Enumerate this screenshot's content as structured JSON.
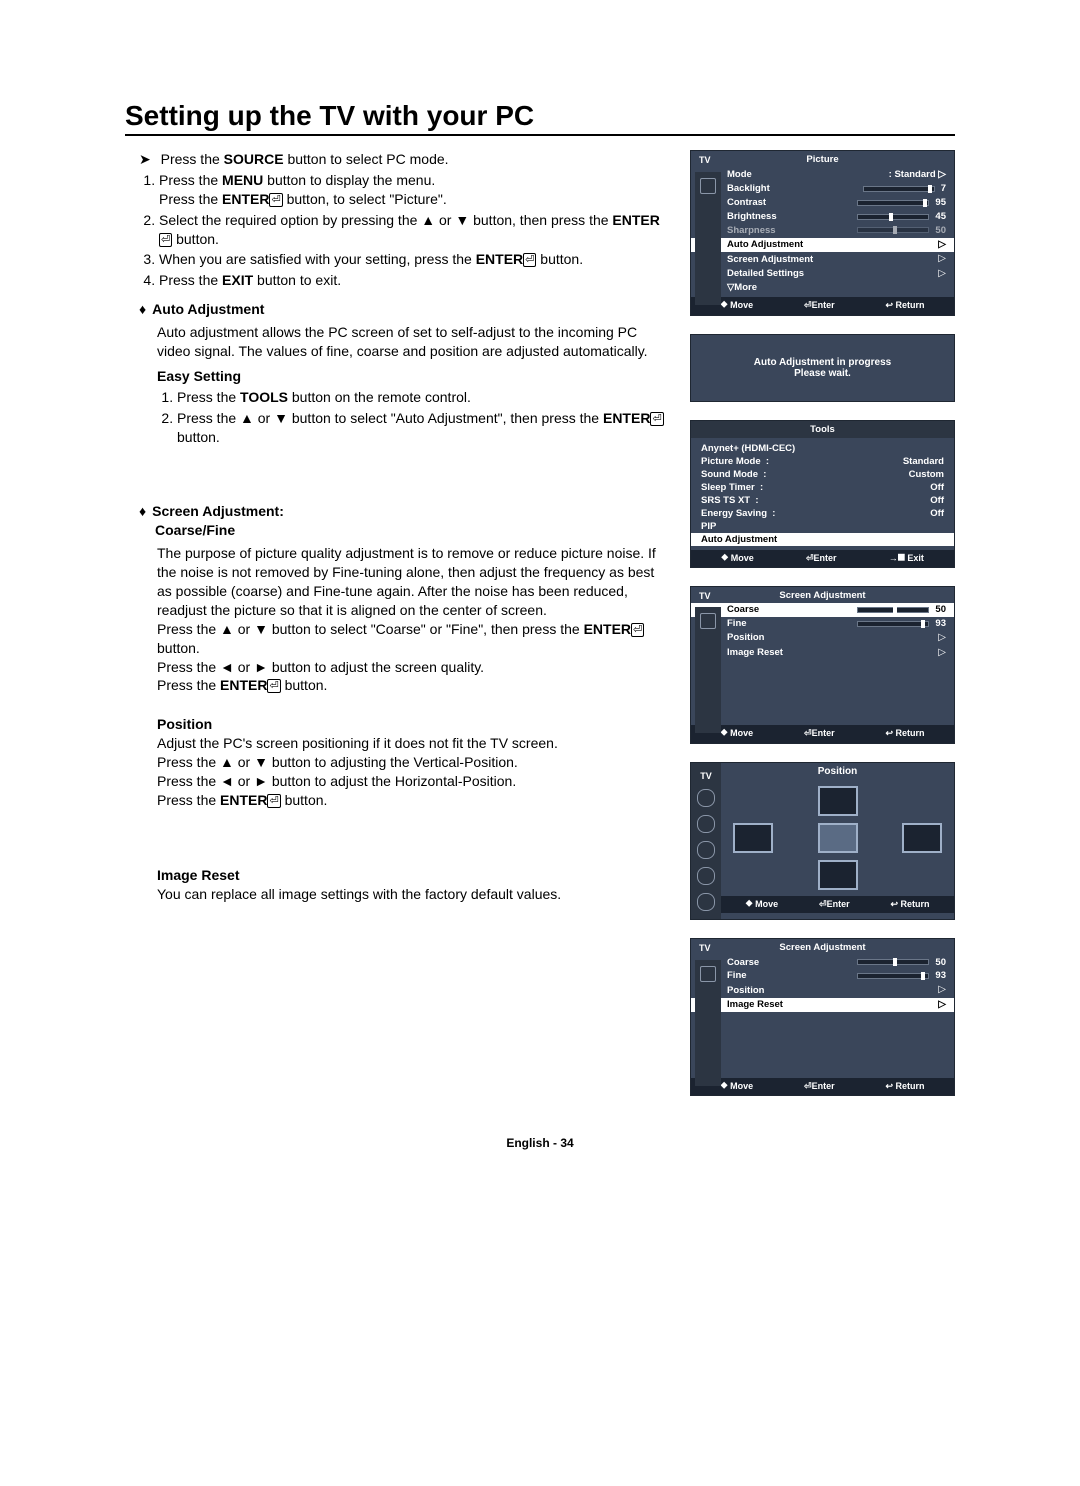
{
  "page": {
    "title": "Setting up the TV with your PC",
    "footer": "English - 34"
  },
  "lead": "Press the SOURCE button to select PC mode.",
  "steps_bold": {
    "source": "SOURCE",
    "menu": "MENU",
    "enter": "ENTER",
    "exit": "EXIT"
  },
  "steps": [
    "Press the MENU button to display the menu.\nPress the ENTER⏎ button, to select \"Picture\".",
    "Select the required option by pressing the ▲ or ▼ button, then press the ENTER⏎ button.",
    "When you are satisfied with your setting, press the ENTER⏎ button.",
    "Press the EXIT button to exit."
  ],
  "sections": {
    "auto": {
      "heading": "Auto Adjustment",
      "body": "Auto adjustment allows the PC screen of set to self-adjust to the incoming PC video signal. The values of fine, coarse and position are adjusted automatically."
    },
    "easy": {
      "heading": "Easy Setting",
      "items": [
        "Press the TOOLS button on the remote control.",
        "Press the ▲ or ▼ button to select \"Auto Adjustment\", then press the ENTER⏎ button."
      ],
      "tools_bold": "TOOLS"
    },
    "screen": {
      "heading": "Screen Adjustment:",
      "heading2": "Coarse/Fine",
      "body": "The purpose of picture quality adjustment is to remove or reduce picture noise. If the noise is not removed by Fine-tuning alone, then adjust the frequency as best as possible (coarse) and Fine-tune again. After the noise has been reduced, readjust the picture so that it is aligned on the center of screen.",
      "body2": "Press the ▲ or ▼ button to select \"Coarse\" or \"Fine\", then press the ENTER⏎ button.",
      "body3": "Press the ◄ or ► button to adjust the screen quality.",
      "body4": "Press the ENTER⏎ button."
    },
    "position": {
      "heading": "Position",
      "l1": "Adjust the PC's screen positioning if it does not fit the TV screen.",
      "l2": "Press the ▲ or ▼ button to adjusting the Vertical-Position.",
      "l3": "Press the ◄ or ► button to adjust the Horizontal-Position.",
      "l4": "Press the ENTER⏎ button."
    },
    "reset": {
      "heading": "Image Reset",
      "body": "You can replace all image settings with the factory default values."
    }
  },
  "osd_picture": {
    "tv": "TV",
    "title": "Picture",
    "rows": [
      {
        "label": "Mode",
        "value": ": Standard",
        "tri": true
      },
      {
        "label": "Backlight",
        "bar": 95,
        "value": "7"
      },
      {
        "label": "Contrast",
        "bar": 95,
        "value": "95"
      },
      {
        "label": "Brightness",
        "bar": 45,
        "value": "45"
      },
      {
        "label": "Sharpness",
        "bar": 50,
        "value": "50",
        "dim": true
      }
    ],
    "sel": "Auto Adjustment",
    "more": [
      "Screen Adjustment",
      "Detailed Settings",
      "▽More"
    ],
    "foot": [
      "⯁ Move",
      "⏎Enter",
      "↩ Return"
    ]
  },
  "modal": {
    "l1": "Auto Adjustment in progress",
    "l2": "Please wait."
  },
  "tools": {
    "title": "Tools",
    "rows": [
      {
        "label": "Anynet+ (HDMI-CEC)"
      },
      {
        "label": "Picture Mode",
        "value": "Standard"
      },
      {
        "label": "Sound Mode",
        "value": "Custom"
      },
      {
        "label": "Sleep Timer",
        "value": "Off"
      },
      {
        "label": "SRS TS XT",
        "value": "Off"
      },
      {
        "label": "Energy Saving",
        "value": "Off"
      },
      {
        "label": "PIP"
      }
    ],
    "sel": "Auto Adjustment",
    "foot": [
      "⯁ Move",
      "⏎Enter",
      "→⯀ Exit"
    ]
  },
  "osd_screen1": {
    "tv": "TV",
    "title": "Screen Adjustment",
    "rows": [
      {
        "label": "Coarse",
        "bar": 50,
        "value": "50",
        "sel": true
      },
      {
        "label": "Fine",
        "bar": 93,
        "value": "93"
      },
      {
        "label": "Position",
        "tri": true
      },
      {
        "label": "Image Reset",
        "tri": true
      }
    ],
    "foot": [
      "⯁ Move",
      "⏎Enter",
      "↩ Return"
    ]
  },
  "osd_position": {
    "tv": "TV",
    "title": "Position",
    "foot": [
      "⯁ Move",
      "⏎Enter",
      "↩ Return"
    ]
  },
  "osd_screen2": {
    "tv": "TV",
    "title": "Screen Adjustment",
    "rows": [
      {
        "label": "Coarse",
        "bar": 50,
        "value": "50"
      },
      {
        "label": "Fine",
        "bar": 93,
        "value": "93"
      },
      {
        "label": "Position",
        "tri": true
      },
      {
        "label": "Image Reset",
        "tri": true,
        "sel": true
      }
    ],
    "foot": [
      "⯁ Move",
      "⏎Enter",
      "↩ Return"
    ]
  }
}
